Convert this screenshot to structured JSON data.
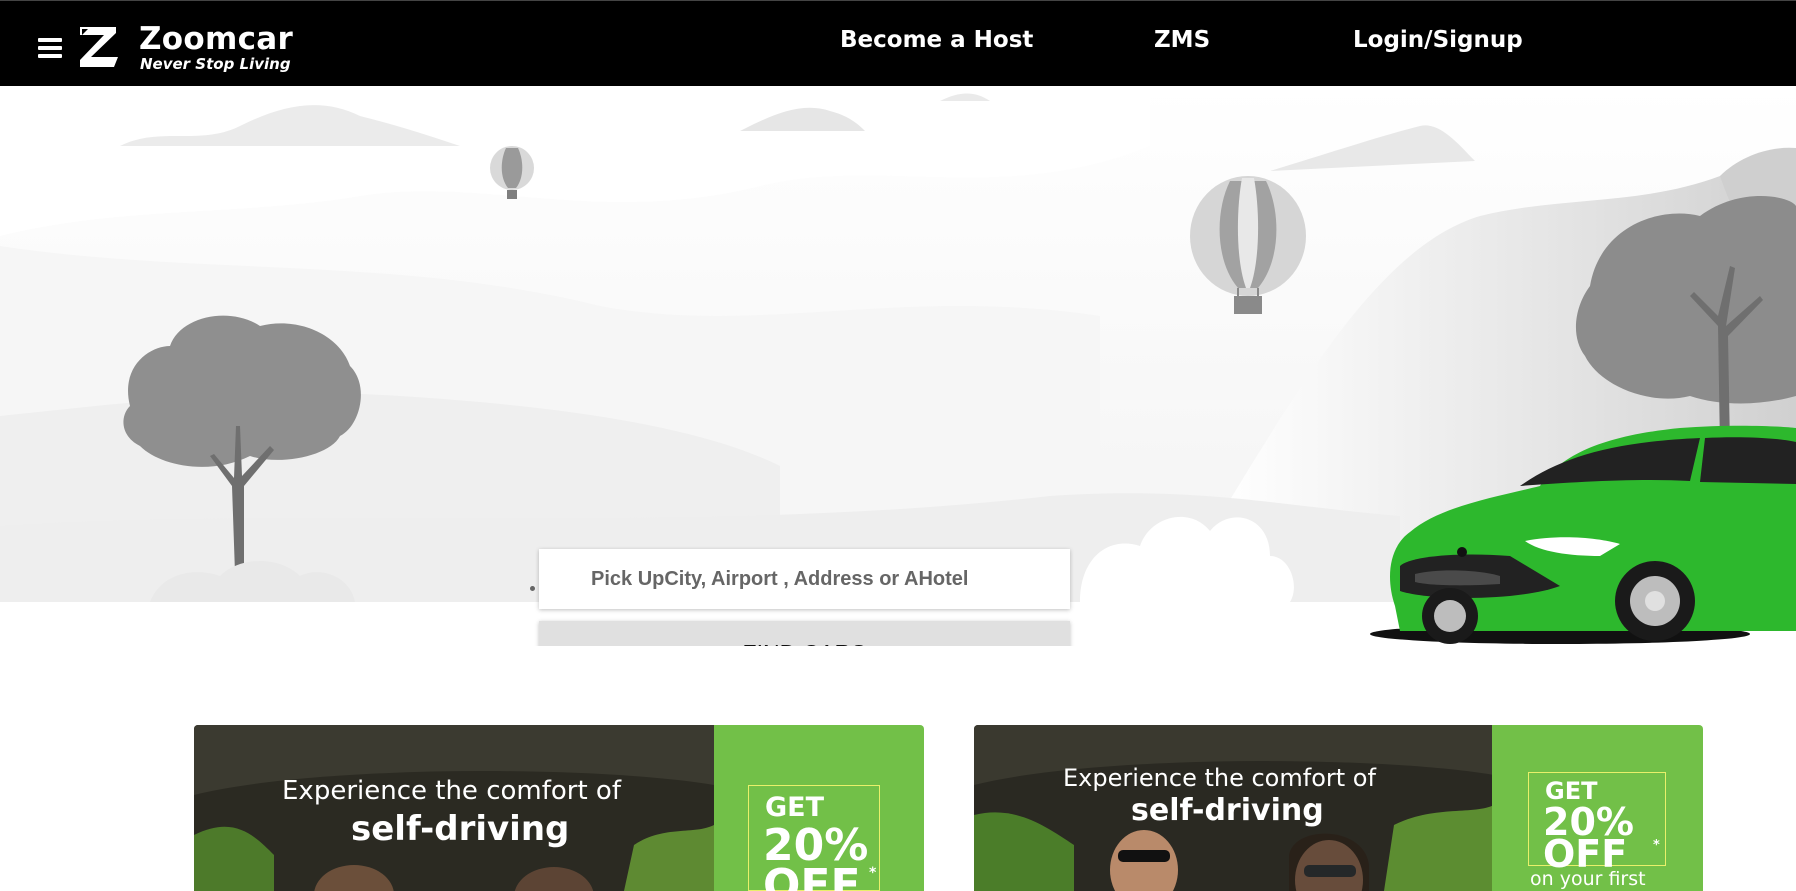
{
  "header": {
    "brand": "Zoomcar",
    "tagline": "Never Stop Living",
    "nav": [
      "Become a Host",
      "ZMS",
      "Login/Signup"
    ]
  },
  "hero": {
    "search_placeholder": "Pick UpCity, Airport , Address or AHotel",
    "find_button": "FIND CARS"
  },
  "promos": [
    {
      "line1": "Experience the comfort of",
      "line2": "self-driving",
      "offer_get": "GET",
      "offer_pct": "20%",
      "offer_off": "OFF",
      "offer_star": "*",
      "offer_sub": ""
    },
    {
      "line1": "Experience the comfort of",
      "line2": "self-driving",
      "offer_get": "GET",
      "offer_pct": "20%",
      "offer_off": "OFF",
      "offer_star": "*",
      "offer_sub": "on your first"
    }
  ],
  "colors": {
    "header_bg": "#000000",
    "brand_green": "#2db82d",
    "promo_green": "#72c048",
    "button_grey": "#e0e0e0"
  },
  "icons": [
    "hamburger-menu-icon",
    "zoomcar-logo-icon",
    "hot-air-balloon-icon",
    "green-car-illustration"
  ]
}
